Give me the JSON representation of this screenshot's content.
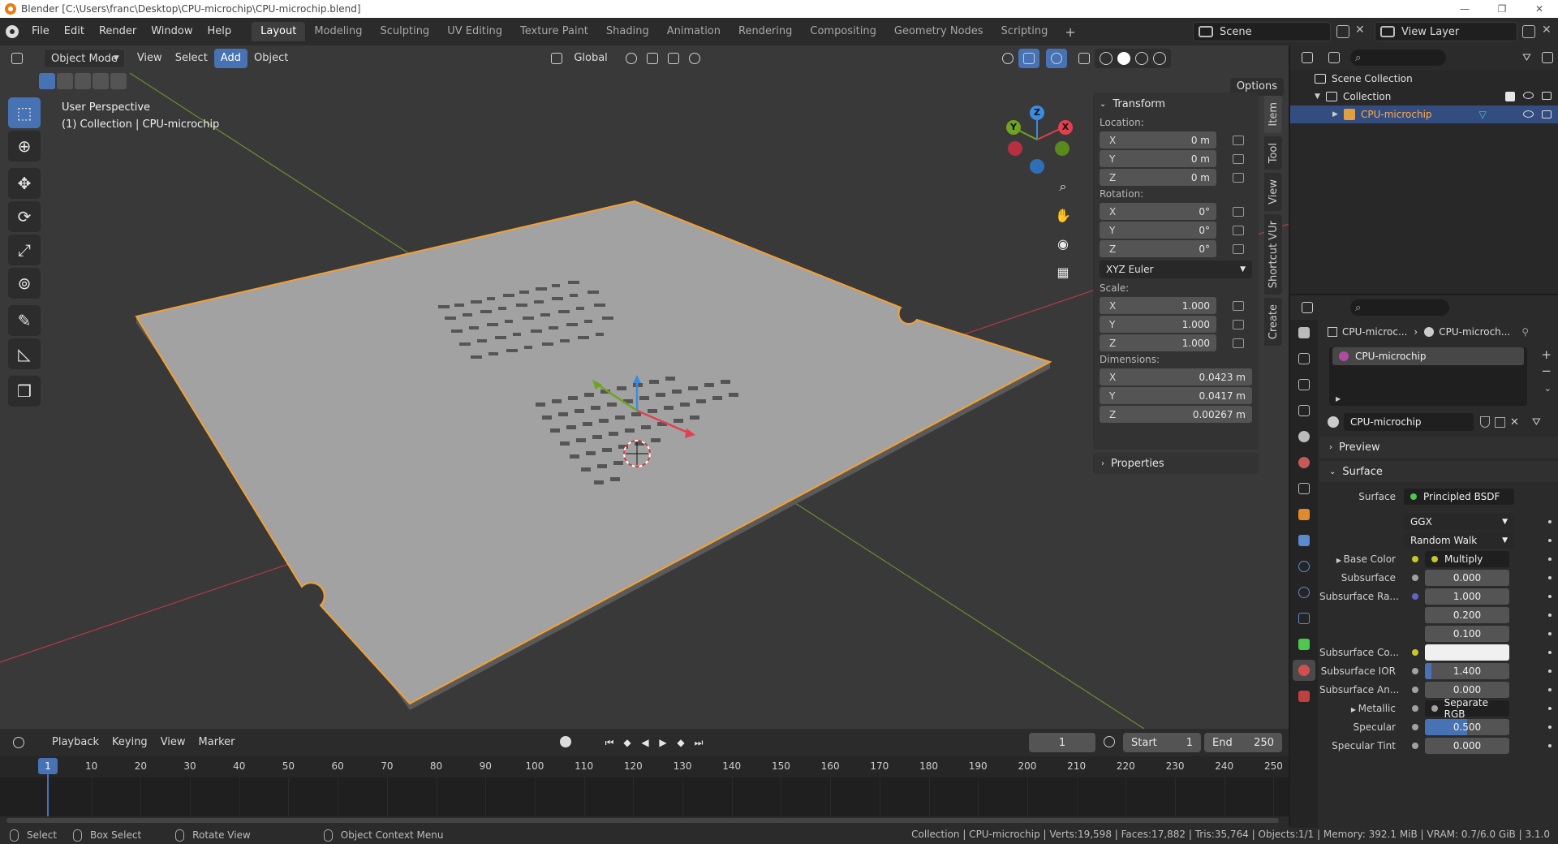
{
  "window": {
    "title": "Blender [C:\\Users\\franc\\Desktop\\CPU-microchip\\CPU-microchip.blend]",
    "controls": [
      "—",
      "❐",
      "✕"
    ]
  },
  "menu": [
    "File",
    "Edit",
    "Render",
    "Window",
    "Help"
  ],
  "workspaces": [
    "Layout",
    "Modeling",
    "Sculpting",
    "UV Editing",
    "Texture Paint",
    "Shading",
    "Animation",
    "Rendering",
    "Compositing",
    "Geometry Nodes",
    "Scripting"
  ],
  "active_workspace": "Layout",
  "scene": {
    "name": "Scene",
    "view_layer": "View Layer"
  },
  "viewport": {
    "mode": "Object Mode",
    "menus": [
      "View",
      "Select",
      "Add",
      "Object"
    ],
    "active_menu": "Add",
    "orientation": "Global",
    "options_label": "Options",
    "info_line1": "User Perspective",
    "info_line2": "(1) Collection | CPU-microchip",
    "gizmo": {
      "x": "X",
      "y": "Y",
      "z": "Z",
      "x_color": "#e0414f",
      "y_color": "#6ea323",
      "z_color": "#3d8be0"
    },
    "side_tabs": [
      "Item",
      "Tool",
      "View",
      "Shortcut VUr",
      "Create"
    ]
  },
  "transform": {
    "title": "Transform",
    "location_label": "Location:",
    "location": {
      "x": "0 m",
      "y": "0 m",
      "z": "0 m"
    },
    "rotation_label": "Rotation:",
    "rotation": {
      "x": "0°",
      "y": "0°",
      "z": "0°"
    },
    "rotation_mode": "XYZ Euler",
    "scale_label": "Scale:",
    "scale": {
      "x": "1.000",
      "y": "1.000",
      "z": "1.000"
    },
    "dimensions_label": "Dimensions:",
    "dimensions": {
      "x": "0.0423 m",
      "y": "0.0417 m",
      "z": "0.00267 m"
    },
    "axis": {
      "x": "X",
      "y": "Y",
      "z": "Z"
    },
    "properties_label": "Properties"
  },
  "timeline": {
    "menus": [
      "Playback",
      "Keying",
      "View",
      "Marker"
    ],
    "current_frame": "1",
    "start_label": "Start",
    "start": "1",
    "end_label": "End",
    "end": "250",
    "ticks": [
      "10",
      "20",
      "30",
      "40",
      "50",
      "60",
      "70",
      "80",
      "90",
      "100",
      "110",
      "120",
      "130",
      "140",
      "150",
      "160",
      "170",
      "180",
      "190",
      "200",
      "210",
      "220",
      "230",
      "240",
      "250"
    ],
    "playhead_label": "1"
  },
  "statusbar": {
    "select": "Select",
    "box_select": "Box Select",
    "rotate": "Rotate View",
    "context_menu": "Object Context Menu",
    "stats": "Collection | CPU-microchip | Verts:19,598 | Faces:17,882 | Tris:35,764 | Objects:1/1 | Memory: 392.1 MiB | VRAM: 0.7/6.0 GiB | 3.1.0"
  },
  "outliner": {
    "scene_collection": "Scene Collection",
    "collection": "Collection",
    "object": "CPU-microchip"
  },
  "properties": {
    "breadcrumb_object": "CPU-microc...",
    "breadcrumb_material": "CPU-microch...",
    "slot_name": "CPU-microchip",
    "material_name": "CPU-microchip",
    "preview_label": "Preview",
    "surface_section": "Surface",
    "surface_label": "Surface",
    "surface_value": "Principled BSDF",
    "distribution": "GGX",
    "subsurface_method": "Random Walk",
    "rows": [
      {
        "label": "Base Color",
        "value": "Multiply",
        "kind": "link",
        "sock": "#c7c729",
        "expand": true
      },
      {
        "label": "Subsurface",
        "value": "0.000",
        "kind": "num",
        "sock": "#a1a1a1"
      },
      {
        "label": "Subsurface Ra...",
        "value": "1.000",
        "kind": "num",
        "sock": "#6363c7"
      },
      {
        "label": "",
        "value": "0.200",
        "kind": "num"
      },
      {
        "label": "",
        "value": "0.100",
        "kind": "num"
      },
      {
        "label": "Subsurface Co...",
        "value": "",
        "kind": "color",
        "sock": "#c7c729"
      },
      {
        "label": "Subsurface IOR",
        "value": "1.400",
        "kind": "num",
        "sock": "#a1a1a1",
        "fill": 0.08
      },
      {
        "label": "Subsurface An...",
        "value": "0.000",
        "kind": "num",
        "sock": "#a1a1a1"
      },
      {
        "label": "Metallic",
        "value": "Separate RGB",
        "kind": "link",
        "sock": "#a1a1a1",
        "expand": true
      },
      {
        "label": "Specular",
        "value": "0.500",
        "kind": "num",
        "sock": "#a1a1a1",
        "fill": 0.5
      },
      {
        "label": "Specular Tint",
        "value": "0.000",
        "kind": "num",
        "sock": "#a1a1a1"
      }
    ]
  }
}
